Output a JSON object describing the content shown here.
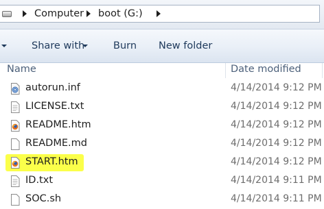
{
  "address": {
    "crumbs": [
      "Computer",
      "boot (G:)"
    ],
    "icon": "drive-icon"
  },
  "toolbar": {
    "share_label": "Share with",
    "burn_label": "Burn",
    "newfolder_label": "New folder"
  },
  "columns": {
    "name": "Name",
    "date": "Date modified"
  },
  "files": [
    {
      "name": "autorun.inf",
      "date": "4/14/2014 9:12 PM",
      "icon": "settings-file-icon"
    },
    {
      "name": "LICENSE.txt",
      "date": "4/14/2014 9:12 PM",
      "icon": "text-file-icon"
    },
    {
      "name": "README.htm",
      "date": "4/14/2014 9:12 PM",
      "icon": "firefox-html-icon"
    },
    {
      "name": "README.md",
      "date": "4/14/2014 9:12 PM",
      "icon": "text-file-icon"
    },
    {
      "name": "START.htm",
      "date": "4/14/2014 9:12 PM",
      "icon": "firefox-html-icon",
      "highlighted": true
    },
    {
      "name": "ID.txt",
      "date": "4/14/2014 9:11 PM",
      "icon": "text-file-icon"
    },
    {
      "name": "SOC.sh",
      "date": "4/14/2014 9:11 PM",
      "icon": "text-file-icon"
    }
  ],
  "colors": {
    "highlight": "#fbff4a",
    "command_text": "#1e395b",
    "header_text": "#4c607a",
    "date_text": "#6d6d6d"
  }
}
